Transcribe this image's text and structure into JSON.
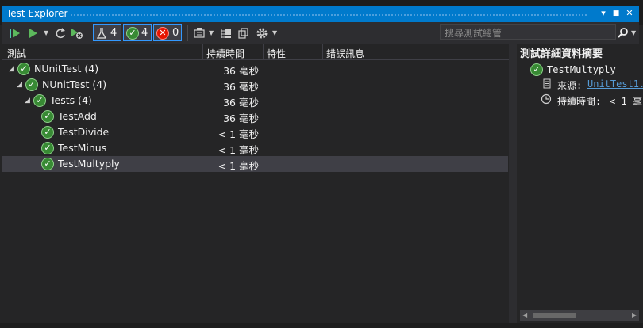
{
  "window": {
    "title": "Test Explorer",
    "buttons": [
      "▾",
      "■",
      "✕"
    ]
  },
  "toolbar": {
    "filters": {
      "playlist_count": "4",
      "passed_count": "4",
      "failed_count": "0"
    },
    "search_placeholder": "搜尋測試總管"
  },
  "grid": {
    "columns": [
      "測試",
      "持續時間",
      "特性",
      "錯誤訊息"
    ],
    "rows": [
      {
        "name": "NUnitTest (4)",
        "duration": "36 毫秒",
        "level": 0,
        "expanded": true
      },
      {
        "name": "NUnitTest (4)",
        "duration": "36 毫秒",
        "level": 1,
        "expanded": true
      },
      {
        "name": "Tests (4)",
        "duration": "36 毫秒",
        "level": 2,
        "expanded": true
      },
      {
        "name": "TestAdd",
        "duration": "36 毫秒",
        "level": 3
      },
      {
        "name": "TestDivide",
        "duration": "< 1 毫秒",
        "level": 3
      },
      {
        "name": "TestMinus",
        "duration": "< 1 毫秒",
        "level": 3
      },
      {
        "name": "TestMultyply",
        "duration": "< 1 毫秒",
        "level": 3,
        "selected": true
      }
    ]
  },
  "detail": {
    "title": "測試詳細資料摘要",
    "test_name": "TestMultyply",
    "source_label": "來源:",
    "source_link": "UnitTest1.",
    "duration_label": "持續時間:",
    "duration_value": "< 1 毫"
  },
  "colors": {
    "accent": "#007acc",
    "pass": "#388a34",
    "fail": "#e51400",
    "link": "#569cd6",
    "selected_row": "#3f3f46"
  }
}
